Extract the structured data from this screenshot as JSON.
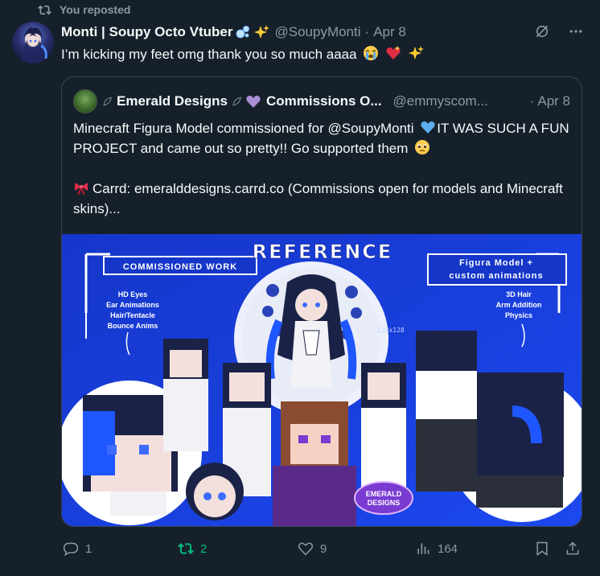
{
  "repost": {
    "label": "You reposted"
  },
  "tweet": {
    "display_name": "Monti | Soupy Octo Vtuber",
    "name_emojis": [
      "bubbles-emoji",
      "sparkles-emoji"
    ],
    "handle": "@SoupyMonti",
    "separator": "·",
    "date": "Apr 8",
    "text": "I’m kicking my feet omg thank you so much aaaa",
    "text_emojis": [
      "crying-face-emoji",
      "sparkling-heart-emoji",
      "sparkles-emoji"
    ]
  },
  "quote": {
    "display_name": "Emerald Designs",
    "name_suffix": "Commissions O...",
    "handle": "@emmyscom...",
    "separator": "·",
    "date": "Apr 8",
    "line1": "Minecraft Figura Model commissioned for @SoupyMonti",
    "line1_tail": "IT WAS SUCH A FUN PROJECT and came out so pretty!! Go supported them",
    "line2": "Carrd: emeralddesigns.carrd.co (Commissions open for models and Minecraft skins)...",
    "image": {
      "title": "REFERENCE",
      "left_banner": "COMMISSIONED WORK",
      "left_features": [
        "HD Eyes",
        "Ear Animations",
        "Hair/Tentacle",
        "Bounce Anims"
      ],
      "right_banner_1": "Figura Model +",
      "right_banner_2": "custom animations",
      "right_features": [
        "3D Hair",
        "Arm Addition",
        "Physics"
      ],
      "size_label": "128x128",
      "logo_1": "EMERALD",
      "logo_2": "DESIGNS",
      "colors": {
        "background": "#1537d8",
        "frame": "#ffffff",
        "hair": "#1a2247"
      }
    }
  },
  "actions": {
    "replies": "1",
    "reposts": "2",
    "likes": "9",
    "views": "164"
  },
  "colors": {
    "background": "#15202b",
    "border": "#38444d",
    "muted": "#8b98a5",
    "text": "#f7f9f9",
    "repost_active": "#00ba7c"
  }
}
